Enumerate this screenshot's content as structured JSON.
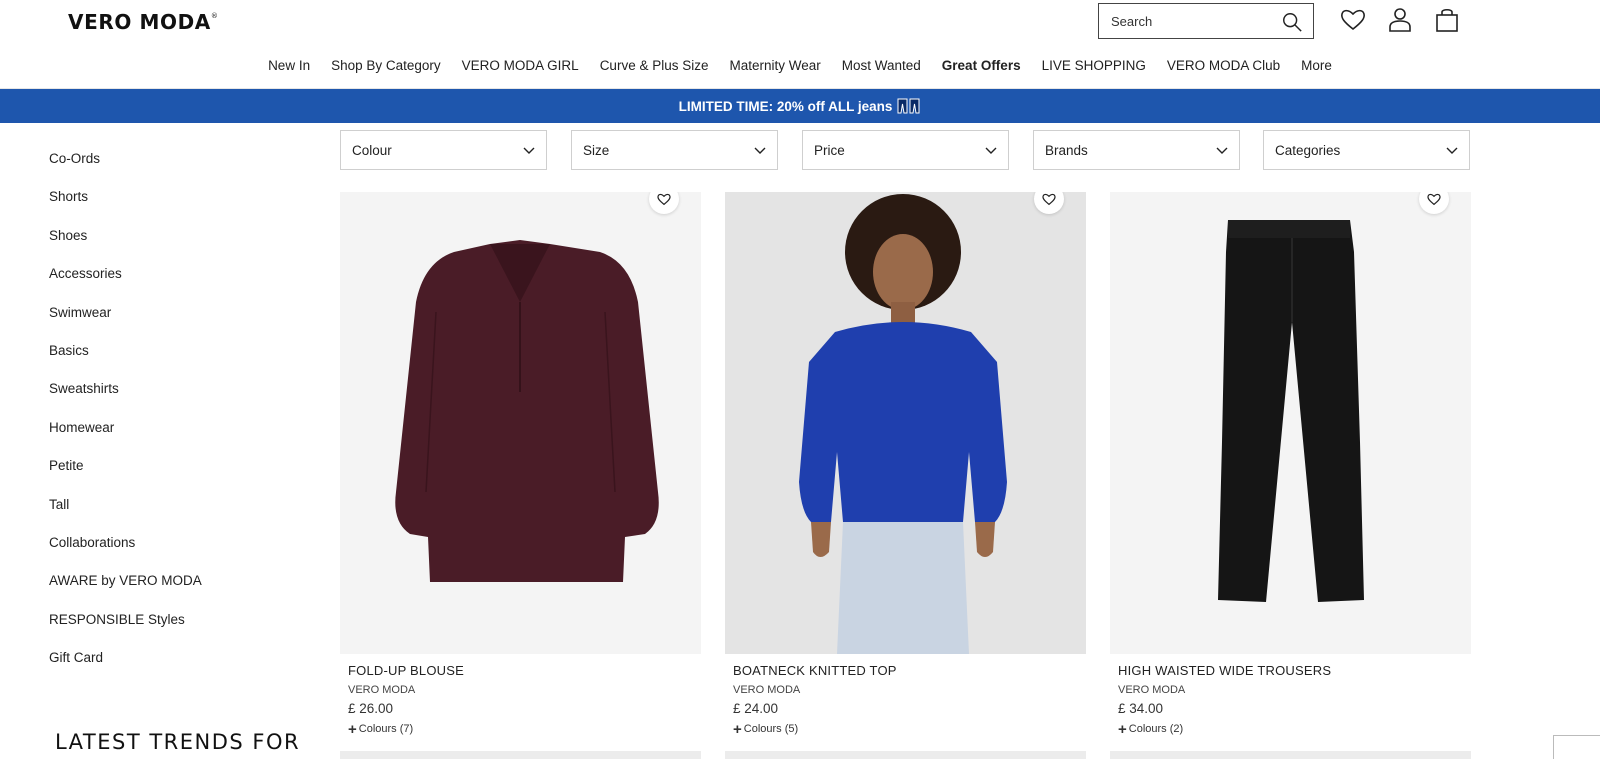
{
  "header": {
    "logo": "VERO MODA",
    "logo_mark": "®",
    "search_placeholder": "Search"
  },
  "nav": [
    {
      "label": "New In"
    },
    {
      "label": "Shop By Category"
    },
    {
      "label": "VERO MODA GIRL"
    },
    {
      "label": "Curve & Plus Size"
    },
    {
      "label": "Maternity Wear"
    },
    {
      "label": "Most Wanted"
    },
    {
      "label": "Great Offers"
    },
    {
      "label": "LIVE SHOPPING"
    },
    {
      "label": "VERO MODA Club"
    },
    {
      "label": "More"
    }
  ],
  "promo": {
    "text": "LIMITED TIME: 20% off ALL jeans",
    "icon": "jeans-icon"
  },
  "sidebar": {
    "categories": [
      "Co-Ords",
      "Shorts",
      "Shoes",
      "Accessories",
      "Swimwear",
      "Basics",
      "Sweatshirts",
      "Homewear",
      "Petite",
      "Tall",
      "Collaborations",
      "AWARE by VERO MODA",
      "RESPONSIBLE Styles",
      "Gift Card"
    ],
    "trends_heading": "LATEST TRENDS FOR"
  },
  "filters": [
    "Colour",
    "Size",
    "Price",
    "Brands",
    "Categories"
  ],
  "products": [
    {
      "name": "FOLD-UP BLOUSE",
      "brand": "VERO MODA",
      "price": "£ 26.00",
      "colours": "Colours (7)",
      "garment_color": "#4a1c27",
      "bg": "#f4f4f4"
    },
    {
      "name": "BOATNECK KNITTED TOP",
      "brand": "VERO MODA",
      "price": "£ 24.00",
      "colours": "Colours (5)",
      "garment_color": "#1f3fae",
      "bg": "#e4e4e4"
    },
    {
      "name": "HIGH WAISTED WIDE TROUSERS",
      "brand": "VERO MODA",
      "price": "£ 34.00",
      "colours": "Colours (2)",
      "garment_color": "#151515",
      "bg": "#f4f4f4"
    }
  ],
  "colors": {
    "promo_bg": "#1e56ad",
    "text": "#1a1a1a"
  }
}
